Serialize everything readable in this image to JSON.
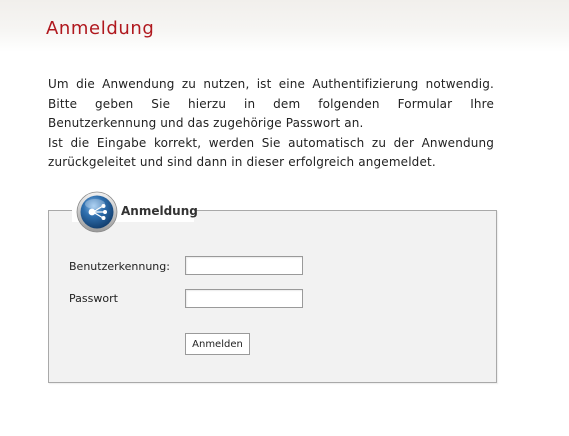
{
  "page": {
    "title": "Anmeldung"
  },
  "intro": {
    "paragraph_1": "Um die Anwendung zu nutzen, ist eine Authentifizierung notwendig. Bitte geben Sie hierzu in dem folgenden Formular Ihre Benutzerkennung und das zugehörige Passwort an.",
    "paragraph_2": "Ist die Eingabe korrekt, werden Sie automatisch zu der Anwendung zurückgeleitet und sind dann in dieser erfolgreich angemeldet."
  },
  "login_form": {
    "legend": "Anmeldung",
    "legend_icon": "login-network-icon",
    "username_label": "Benutzerkennung:",
    "username_value": "",
    "password_label": "Passwort",
    "password_value": "",
    "submit_label": "Anmelden"
  },
  "colors": {
    "title_red": "#b0181e",
    "fieldset_background": "#f2f2f2",
    "icon_blue": "#2f6fae"
  }
}
